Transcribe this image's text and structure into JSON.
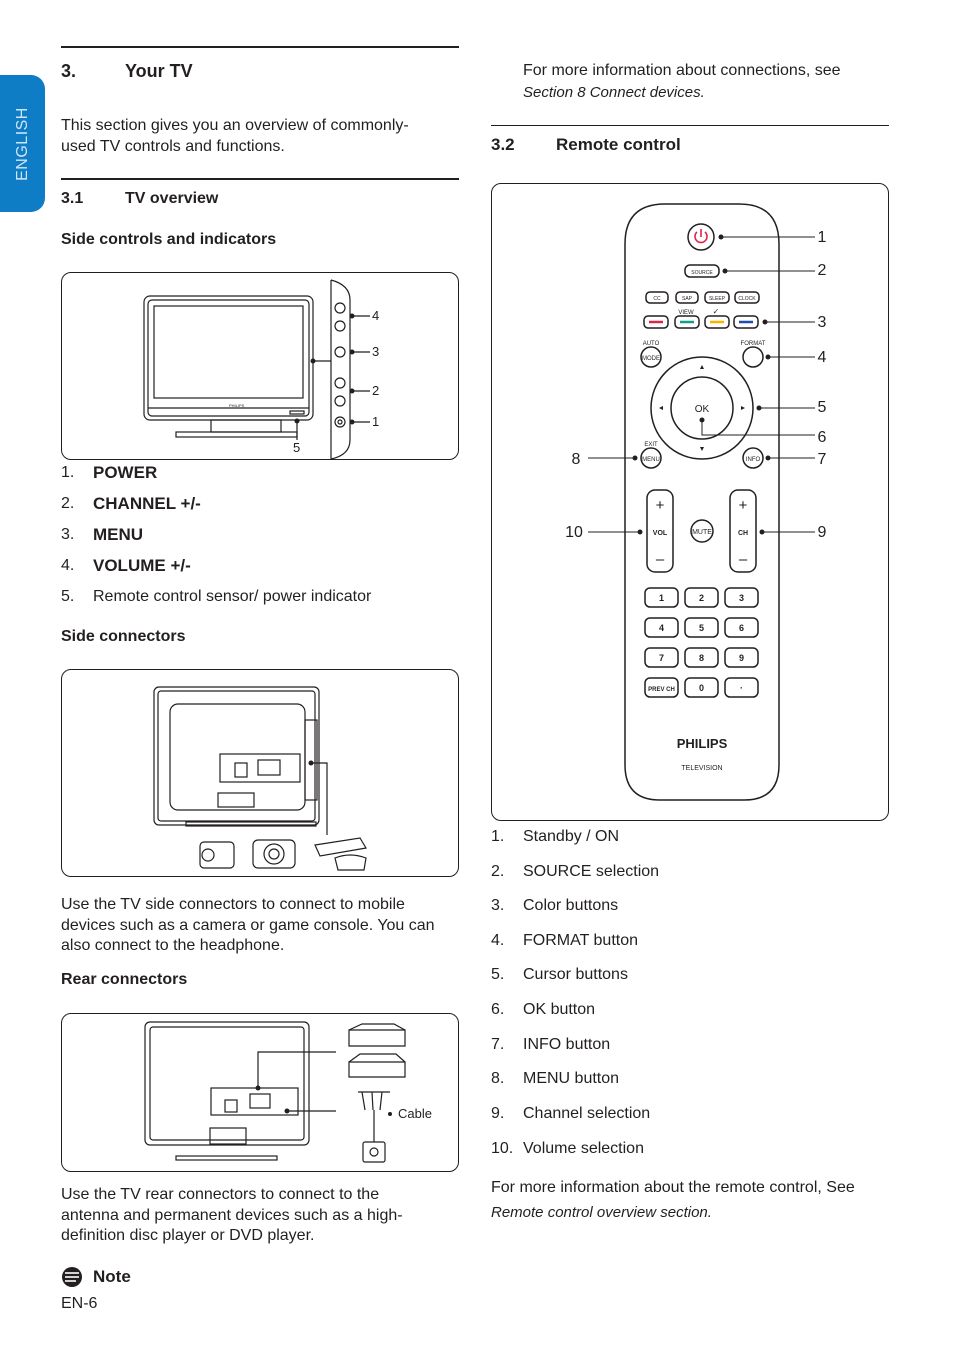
{
  "side_tab": {
    "label": "ENGLISH",
    "color": "#0f7cc6"
  },
  "section3": {
    "number": "3.",
    "title": "Your TV",
    "intro": "This section gives you an overview of commonly-used TV controls and functions."
  },
  "section31": {
    "number": "3.1",
    "title": "TV overview",
    "side_controls": {
      "heading": "Side controls and indicators",
      "callouts": [
        "1",
        "2",
        "3",
        "4",
        "5"
      ],
      "items": [
        {
          "n": "1.",
          "label": "POWER"
        },
        {
          "n": "2.",
          "label": "CHANNEL +/-"
        },
        {
          "n": "3.",
          "label": "MENU"
        },
        {
          "n": "4.",
          "label": "VOLUME +/-"
        },
        {
          "n": "5.",
          "label": "Remote control sensor/ power indicator"
        }
      ]
    },
    "side_connectors": {
      "heading": "Side connectors",
      "text": "Use the TV side connectors to connect to mobile devices such as a camera or game console.  You can also connect to the headphone."
    },
    "rear_connectors": {
      "heading": "Rear connectors",
      "cable_label": "Cable",
      "text": "Use the TV rear connectors to connect to the antenna and permanent devices such as a high-definition disc player or DVD player."
    },
    "note": {
      "label": "Note"
    }
  },
  "right_intro": {
    "text": "For more information about connections, see",
    "ref": "Section 8 Connect devices."
  },
  "section32": {
    "number": "3.2",
    "title": "Remote control",
    "remote": {
      "buttons": {
        "source": "SOURCE",
        "cc": "CC",
        "sap": "SAP",
        "sleep": "SLEEP",
        "clock": "CLOCK",
        "view": "VIEW",
        "check": "✓",
        "auto": "AUTO",
        "mode": "MODE",
        "format": "FORMAT",
        "ok": "OK",
        "exit": "EXIT",
        "menu": "MENU",
        "info": "INFO",
        "vol": "VOL",
        "ch": "CH",
        "mute": "MUTE",
        "plus": "+",
        "minus": "–",
        "digits": [
          "1",
          "2",
          "3",
          "4",
          "5",
          "6",
          "7",
          "8",
          "9",
          "PREV CH",
          "0",
          "·"
        ]
      },
      "color_buttons": [
        "#e0234e",
        "#12a084",
        "#f7b500",
        "#1f4fa8"
      ],
      "power_color": "#e0234e",
      "brand": "PHILIPS",
      "sub_brand": "TELEVISION",
      "callouts": [
        "1",
        "2",
        "3",
        "4",
        "5",
        "6",
        "7",
        "8",
        "9",
        "10"
      ]
    },
    "items": [
      {
        "n": "1.",
        "label": "Standby / ON"
      },
      {
        "n": "2.",
        "label": "SOURCE selection"
      },
      {
        "n": "3.",
        "label": "Color buttons"
      },
      {
        "n": "4.",
        "label": "FORMAT button"
      },
      {
        "n": "5.",
        "label": "Cursor buttons"
      },
      {
        "n": "6.",
        "label": "OK button"
      },
      {
        "n": "7.",
        "label": "INFO button"
      },
      {
        "n": "8.",
        "label": "MENU button"
      },
      {
        "n": "9.",
        "label": "Channel selection"
      },
      {
        "n": "10.",
        "label": "Volume selection"
      }
    ],
    "footer": {
      "text": "For more information about the remote control, See",
      "ref": "Remote control overview section."
    }
  },
  "page_number": "EN-6"
}
